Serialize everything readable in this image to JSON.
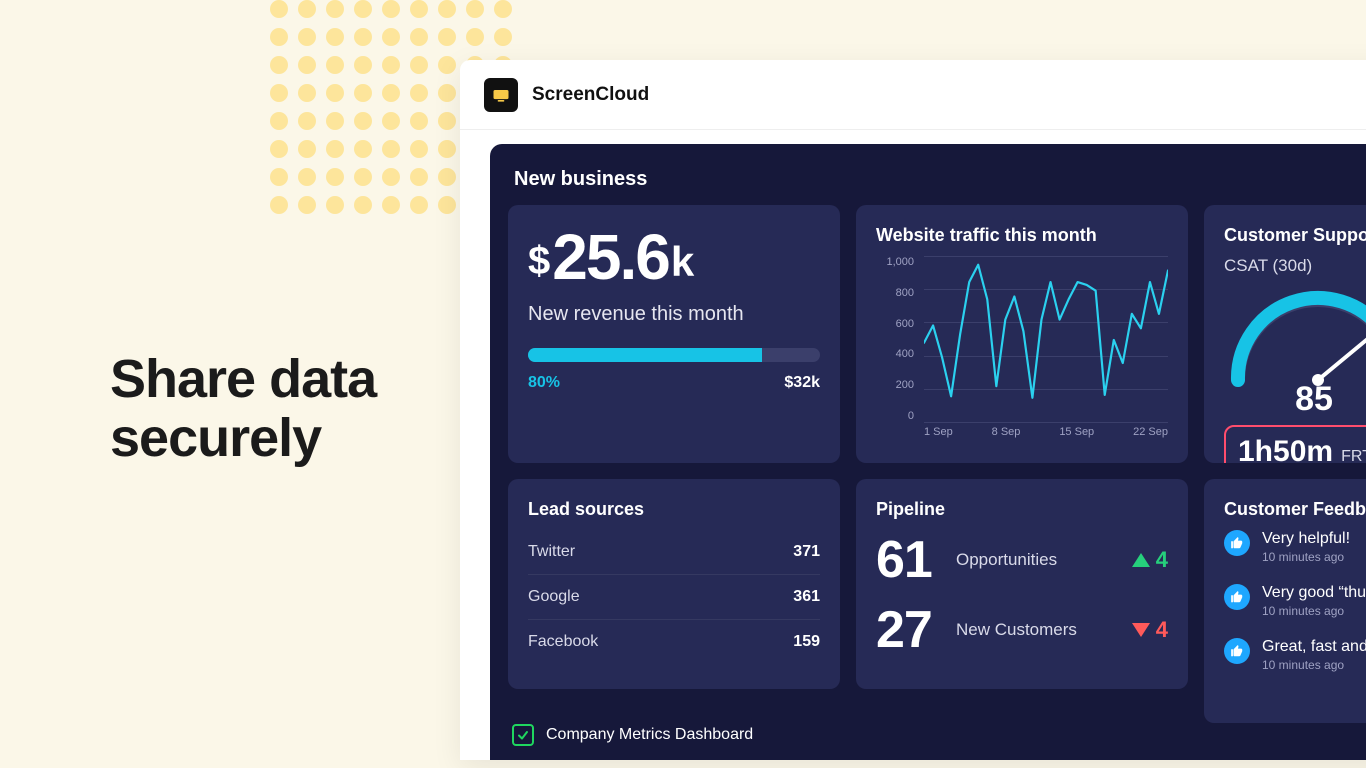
{
  "page": {
    "headline_l1": "Share data",
    "headline_l2": "securely"
  },
  "app": {
    "brand": "ScreenCloud"
  },
  "dashboard": {
    "section_title": "New business",
    "footer_title": "Company Metrics Dashboard",
    "revenue": {
      "currency": "$",
      "value": "25.6",
      "suffix": "k",
      "subtitle": "New revenue this month",
      "progress_pct": 80,
      "progress_label": "80%",
      "target_label": "$32k"
    },
    "traffic": {
      "title": "Website traffic this month"
    },
    "leads": {
      "title": "Lead sources",
      "rows": [
        {
          "name": "Twitter",
          "value": "371"
        },
        {
          "name": "Google",
          "value": "361"
        },
        {
          "name": "Facebook",
          "value": "159"
        }
      ]
    },
    "pipeline": {
      "title": "Pipeline",
      "metrics": [
        {
          "value": "61",
          "label": "Opportunities",
          "delta": "4",
          "dir": "up"
        },
        {
          "value": "27",
          "label": "New Customers",
          "delta": "4",
          "dir": "down"
        }
      ]
    },
    "support": {
      "title": "Customer Support",
      "csat_label": "CSAT (30d)",
      "csat_value": "85",
      "frt_value": "1h50m",
      "frt_label": "FRT"
    },
    "feedback": {
      "title": "Customer Feedback",
      "items": [
        {
          "text": "Very helpful!",
          "time": "10 minutes ago"
        },
        {
          "text": "Very good “thum",
          "time": "10 minutes ago"
        },
        {
          "text": "Great, fast and f",
          "time": "10 minutes ago"
        }
      ]
    }
  },
  "chart_data": {
    "type": "line",
    "title": "Website traffic this month",
    "xlabel": "",
    "ylabel": "",
    "ylim": [
      0,
      1000
    ],
    "y_ticks": [
      1000,
      800,
      600,
      400,
      200,
      0
    ],
    "x_ticks": [
      "1 Sep",
      "8 Sep",
      "15 Sep",
      "22 Sep"
    ],
    "x": [
      1,
      2,
      3,
      4,
      5,
      6,
      7,
      8,
      9,
      10,
      11,
      12,
      13,
      14,
      15,
      16,
      17,
      18,
      19,
      20,
      21,
      22,
      23,
      24,
      25,
      26,
      27,
      28
    ],
    "values": [
      400,
      520,
      300,
      30,
      460,
      820,
      940,
      700,
      100,
      560,
      720,
      480,
      20,
      560,
      820,
      560,
      700,
      820,
      800,
      760,
      40,
      420,
      260,
      600,
      500,
      820,
      600,
      900
    ],
    "color": "#2bd1ef"
  }
}
